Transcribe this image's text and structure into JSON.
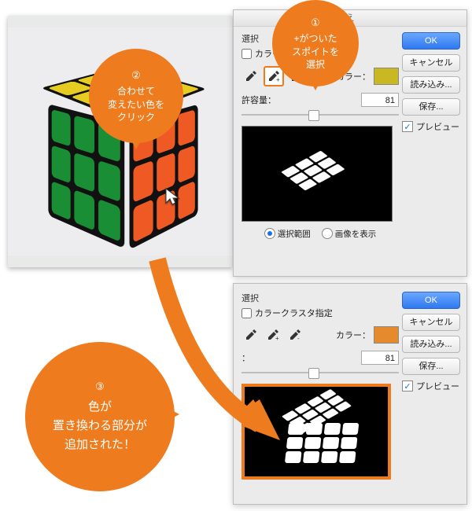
{
  "dialog_title": "え",
  "common": {
    "selection_label": "選択",
    "cluster_label_short": "カラーク",
    "cluster_label_full": "カラークラスタ指定",
    "color_label": "カラー：",
    "tolerance_label": "許容量：",
    "tolerance_label_short": "：",
    "tolerance_value": "81",
    "radio_selection": "選択範囲",
    "radio_image": "画像を表示",
    "buttons": {
      "ok": "OK",
      "cancel": "キャンセル",
      "load": "読み込み...",
      "save": "保存..."
    },
    "preview_label": "プレビュー"
  },
  "panel1": {
    "swatch_color": "#c9b822"
  },
  "panel2": {
    "swatch_color": "#e68a2e"
  },
  "callouts": {
    "c1_badge": "①",
    "c1_l1": "+がついた",
    "c1_l2": "スポイトを",
    "c1_l3": "選択",
    "c2_badge": "②",
    "c2_l1": "合わせて",
    "c2_l2": "変えたい色を",
    "c2_l3": "クリック",
    "c3_badge": "③",
    "c3_l1": "色が",
    "c3_l2": "置き換わる部分が",
    "c3_l3": "追加された！"
  },
  "icons": {
    "eyedrop": "eyedropper-icon",
    "eyedrop_plus": "eyedropper-plus-icon",
    "eyedrop_minus": "eyedropper-minus-icon"
  }
}
